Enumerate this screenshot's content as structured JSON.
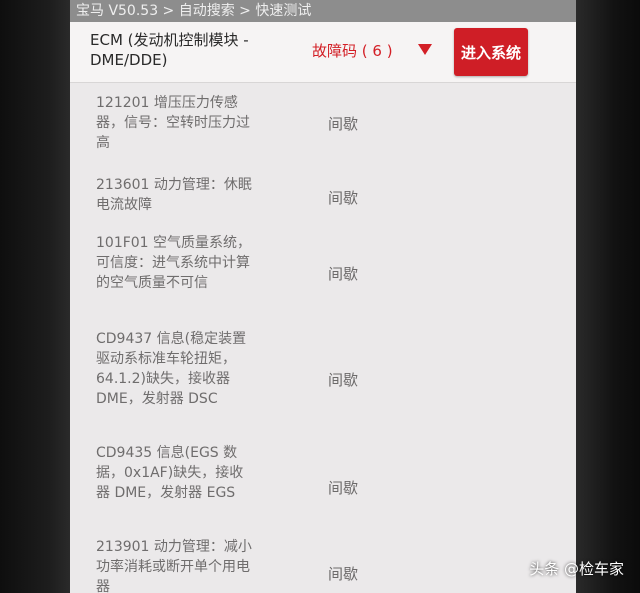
{
  "topbar": {
    "breadcrumb": "宝马 V50.53 > 自动搜索 > 快速测试"
  },
  "header": {
    "module_name": "ECM (发动机控制模块 - DME/DDE)",
    "fault_count": "故障码 ( 6 )",
    "dropdown_icon": "chevron-down-icon",
    "enter_button": "进入系统"
  },
  "faults": [
    {
      "code": "121201 增压压力传感器，信号：空转时压力过高",
      "status": "间歇"
    },
    {
      "code": "213601 动力管理：休眠电流故障",
      "status": "间歇"
    },
    {
      "code": "101F01 空气质量系统，可信度：进气系统中计算的空气质量不可信",
      "status": "间歇"
    },
    {
      "code": "CD9437 信息(稳定装置驱动系标准车轮扭矩，64.1.2)缺失，接收器 DME，发射器 DSC",
      "status": "间歇"
    },
    {
      "code": "CD9435 信息(EGS 数据，0x1AF)缺失，接收器 DME，发射器 EGS",
      "status": "间歇"
    },
    {
      "code": "213901 动力管理：减小功率消耗或断开单个用电器",
      "status": "间歇"
    }
  ],
  "watermark": "头条 @检车家",
  "colors": {
    "accent": "#cf1e26",
    "fault_count": "#d31f26"
  }
}
